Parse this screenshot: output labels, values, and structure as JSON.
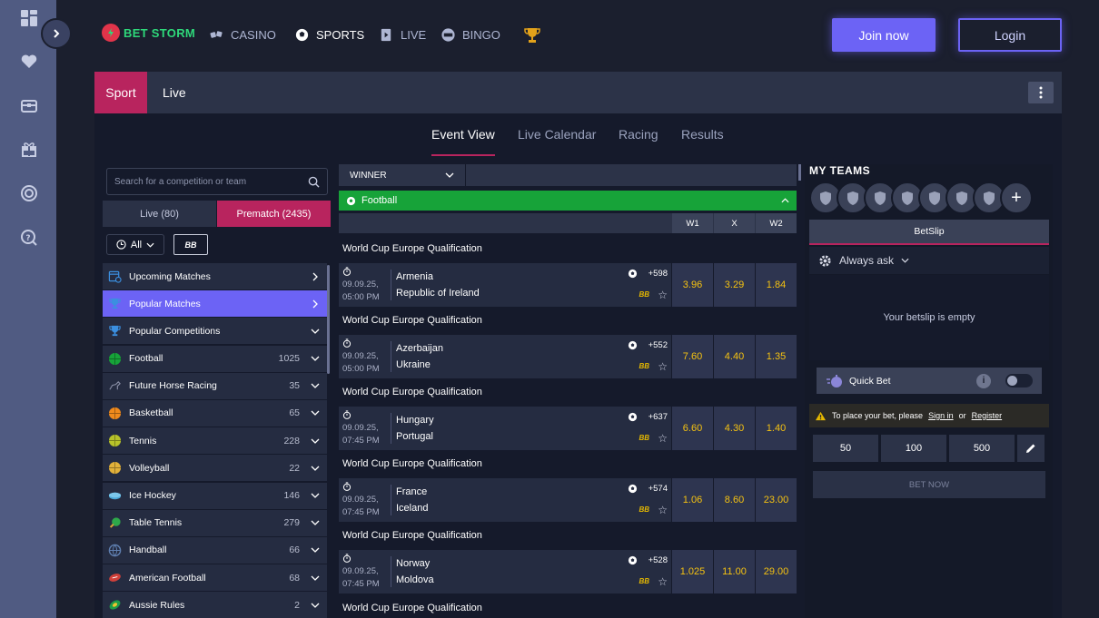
{
  "topbar": {
    "brand": "BET STORM",
    "nav": [
      "CASINO",
      "SPORTS",
      "LIVE",
      "BINGO"
    ],
    "join_label": "Join now",
    "login_label": "Login"
  },
  "sportbar": {
    "tab_sport": "Sport",
    "tab_live": "Live"
  },
  "view_tabs": [
    "Event View",
    "Live Calendar",
    "Racing",
    "Results"
  ],
  "left": {
    "search_placeholder": "Search for a competition or team",
    "seg_live": "Live (80)",
    "seg_prematch": "Prematch (2435)",
    "filter_all": "All",
    "filter_bb": "BB",
    "items": [
      {
        "name": "Upcoming Matches",
        "count": "",
        "icon": "calendar-clock-icon",
        "arrow": "›"
      },
      {
        "name": "Popular Matches",
        "count": "",
        "icon": "trophy-icon",
        "arrow": "›"
      },
      {
        "name": "Popular Competitions",
        "count": "",
        "icon": "trophy-icon",
        "arrow": "⌄"
      },
      {
        "name": "Football",
        "count": "1025",
        "icon": "football-icon",
        "arrow": "⌄"
      },
      {
        "name": "Future Horse Racing",
        "count": "35",
        "icon": "horse-icon",
        "arrow": "⌄"
      },
      {
        "name": "Basketball",
        "count": "65",
        "icon": "basketball-icon",
        "arrow": "⌄"
      },
      {
        "name": "Tennis",
        "count": "228",
        "icon": "tennis-icon",
        "arrow": "⌄"
      },
      {
        "name": "Volleyball",
        "count": "22",
        "icon": "volleyball-icon",
        "arrow": "⌄"
      },
      {
        "name": "Ice Hockey",
        "count": "146",
        "icon": "ice-hockey-icon",
        "arrow": "⌄"
      },
      {
        "name": "Table Tennis",
        "count": "279",
        "icon": "table-tennis-icon",
        "arrow": "⌄"
      },
      {
        "name": "Handball",
        "count": "66",
        "icon": "handball-icon",
        "arrow": "⌄"
      },
      {
        "name": "American Football",
        "count": "68",
        "icon": "american-football-icon",
        "arrow": "⌄"
      },
      {
        "name": "Aussie Rules",
        "count": "2",
        "icon": "aussie-rules-icon",
        "arrow": "⌄"
      }
    ]
  },
  "center": {
    "market": "WINNER",
    "sport": "Football",
    "odds_headers": [
      "W1",
      "X",
      "W2"
    ],
    "matches": [
      {
        "competition": "World Cup Europe Qualification",
        "date": "09.09.25,",
        "time": "05:00 PM",
        "home": "Armenia",
        "away": "Republic of Ireland",
        "more": "+598",
        "odds": [
          "3.96",
          "3.29",
          "1.84"
        ]
      },
      {
        "competition": "World Cup Europe Qualification",
        "date": "09.09.25,",
        "time": "05:00 PM",
        "home": "Azerbaijan",
        "away": "Ukraine",
        "more": "+552",
        "odds": [
          "7.60",
          "4.40",
          "1.35"
        ]
      },
      {
        "competition": "World Cup Europe Qualification",
        "date": "09.09.25,",
        "time": "07:45 PM",
        "home": "Hungary",
        "away": "Portugal",
        "more": "+637",
        "odds": [
          "6.60",
          "4.30",
          "1.40"
        ]
      },
      {
        "competition": "World Cup Europe Qualification",
        "date": "09.09.25,",
        "time": "07:45 PM",
        "home": "France",
        "away": "Iceland",
        "more": "+574",
        "odds": [
          "1.06",
          "8.60",
          "23.00"
        ]
      },
      {
        "competition": "World Cup Europe Qualification",
        "date": "09.09.25,",
        "time": "07:45 PM",
        "home": "Norway",
        "away": "Moldova",
        "more": "+528",
        "odds": [
          "1.025",
          "11.00",
          "29.00"
        ]
      }
    ],
    "last_competition": "World Cup Europe Qualification",
    "bb_badge": "BB",
    "star": "☆"
  },
  "right": {
    "my_teams": "MY TEAMS",
    "betslip_tab": "BetSlip",
    "always_ask": "Always ask",
    "empty": "Your betslip is empty",
    "quick_bet": "Quick Bet",
    "warn_text": "To place your bet, please",
    "sign_in": "Sign in",
    "or": "or",
    "register": "Register",
    "stakes": [
      "50",
      "100",
      "500"
    ],
    "bet_now": "BET NOW"
  },
  "colors": {
    "accent": "#6c63f5",
    "brand_pink": "#b8245e",
    "football_green": "#17a339",
    "odds_yellow": "#f5c211"
  }
}
